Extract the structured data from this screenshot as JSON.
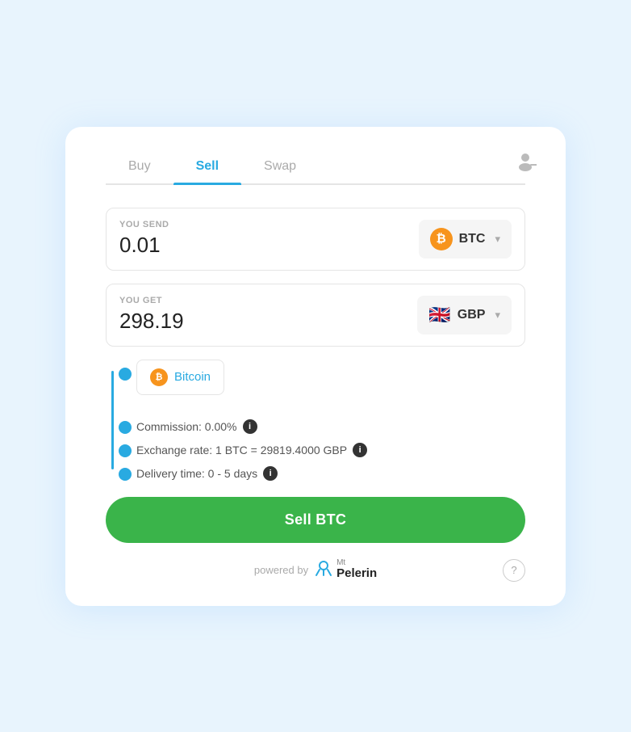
{
  "tabs": [
    {
      "label": "Buy",
      "active": false
    },
    {
      "label": "Sell",
      "active": true
    },
    {
      "label": "Swap",
      "active": false
    }
  ],
  "send_section": {
    "label": "YOU SEND",
    "value": "0.01",
    "currency": "BTC",
    "currency_icon": "₿"
  },
  "get_section": {
    "label": "YOU GET",
    "value": "298.19",
    "currency": "GBP",
    "currency_flag": "🇬🇧"
  },
  "bitcoin_suggestion": {
    "label": "Bitcoin"
  },
  "info_rows": [
    {
      "text": "Commission: 0.00%",
      "has_icon": true
    },
    {
      "text": "Exchange rate: 1 BTC = 29819.4000 GBP",
      "has_icon": true
    },
    {
      "text": "Delivery time: 0 - 5 days",
      "has_icon": true
    }
  ],
  "sell_button": {
    "label": "Sell BTC"
  },
  "footer": {
    "powered_by": "powered by",
    "brand_mt": "Mt",
    "brand_pelerin": "Pelerin"
  },
  "icons": {
    "info": "i",
    "dropdown": "▾",
    "help": "?"
  }
}
